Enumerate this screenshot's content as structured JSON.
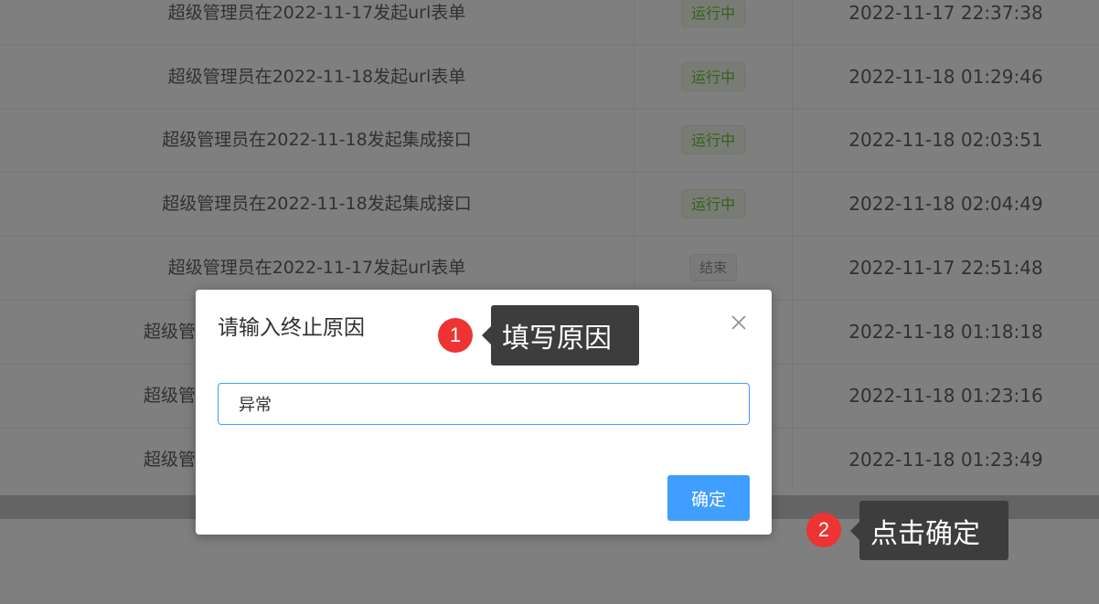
{
  "table": {
    "rows": [
      {
        "title": "超级管理员在2022-11-17发起url表单",
        "status": "运行中",
        "status_type": "running",
        "time": "2022-11-17 22:37:38"
      },
      {
        "title": "超级管理员在2022-11-18发起url表单",
        "status": "运行中",
        "status_type": "running",
        "time": "2022-11-18 01:29:46"
      },
      {
        "title": "超级管理员在2022-11-18发起集成接口",
        "status": "运行中",
        "status_type": "running",
        "time": "2022-11-18 02:03:51"
      },
      {
        "title": "超级管理员在2022-11-18发起集成接口",
        "status": "运行中",
        "status_type": "running",
        "time": "2022-11-18 02:04:49"
      },
      {
        "title": "超级管理员在2022-11-17发起url表单",
        "status": "结束",
        "status_type": "ended",
        "time": "2022-11-17 22:51:48"
      },
      {
        "title": "超级管",
        "status": "",
        "status_type": "",
        "time": "2022-11-18 01:18:18"
      },
      {
        "title": "超级管",
        "status": "",
        "status_type": "",
        "time": "2022-11-18 01:23:16"
      },
      {
        "title": "超级管",
        "status": "",
        "status_type": "",
        "time": "2022-11-18 01:23:49"
      }
    ]
  },
  "dialog": {
    "title": "请输入终止原因",
    "close_icon": "close-icon",
    "input_value": "异常",
    "confirm_label": "确定"
  },
  "annotations": {
    "step1": {
      "number": "1",
      "text": "填写原因"
    },
    "step2": {
      "number": "2",
      "text": "点击确定"
    }
  },
  "colors": {
    "primary": "#409eff",
    "running_tag": "#67c23a",
    "badge": "#ee3333"
  }
}
